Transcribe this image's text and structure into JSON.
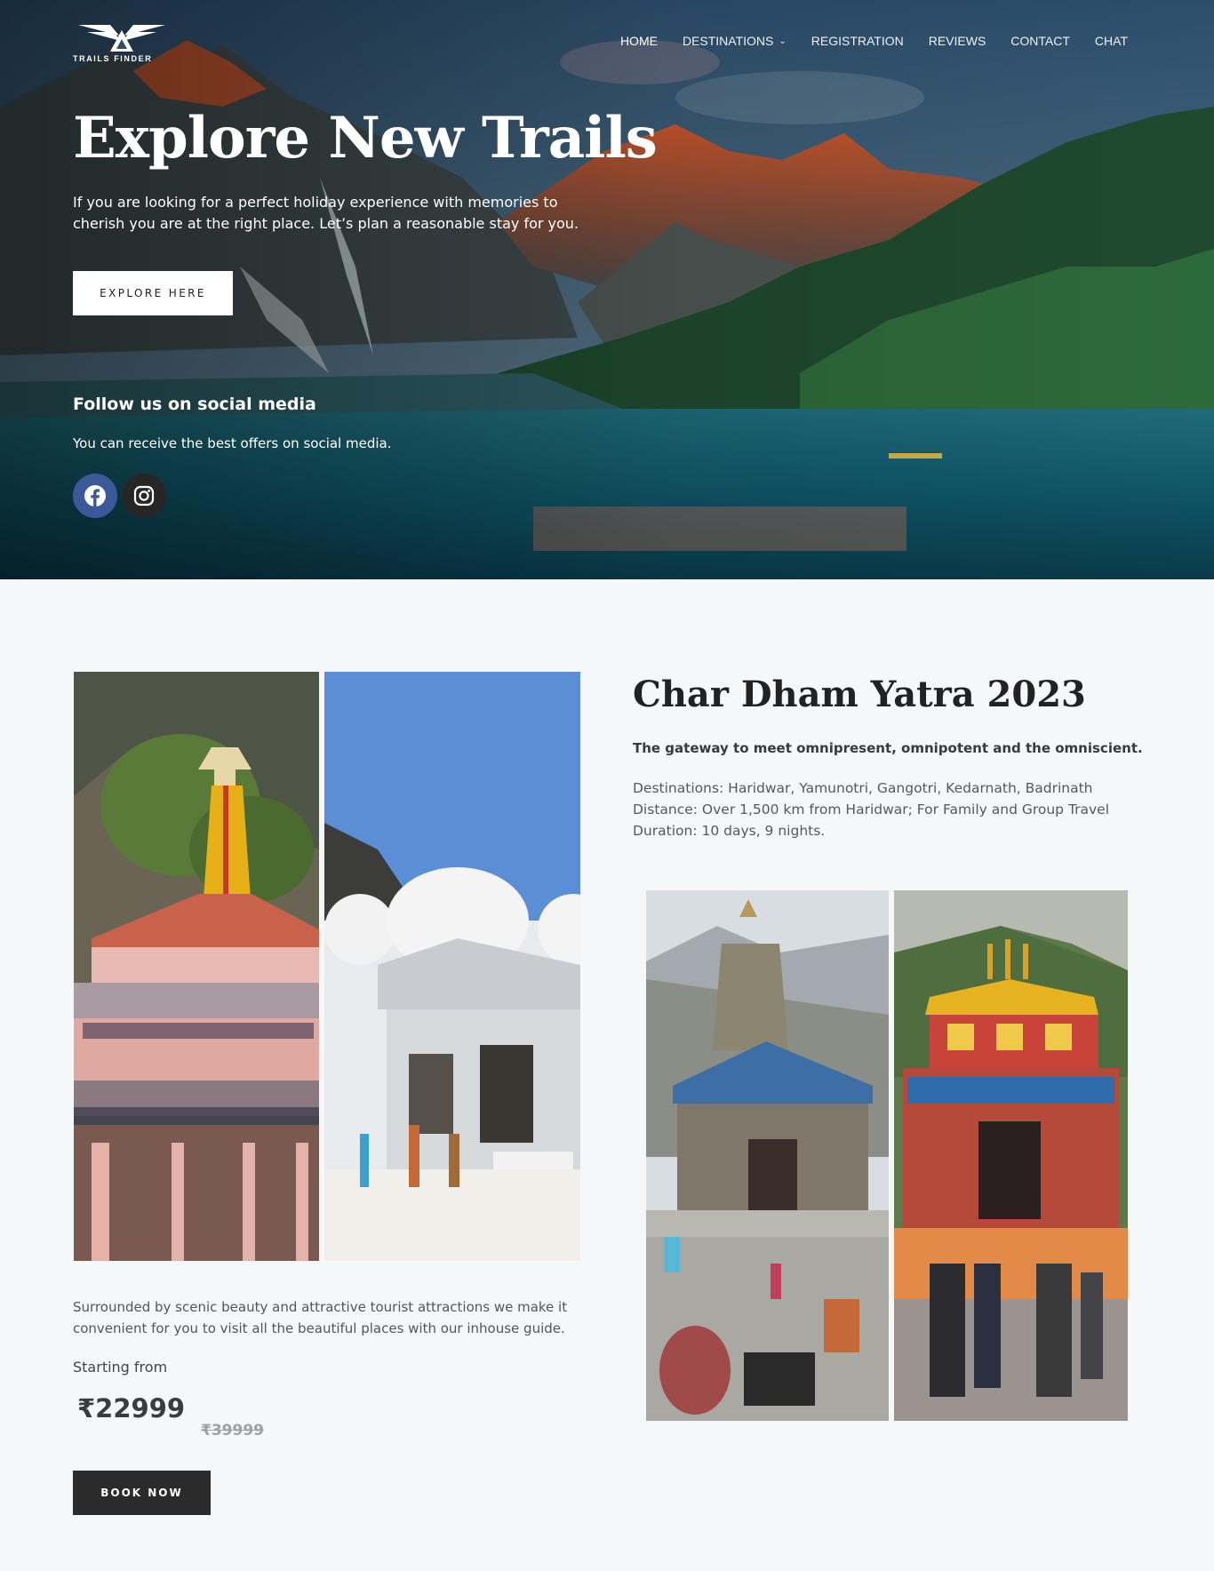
{
  "brand": {
    "logo_text": "TRAILS FINDER"
  },
  "nav": {
    "items": [
      {
        "label": "HOME"
      },
      {
        "label": "DESTINATIONS"
      },
      {
        "label": "REGISTRATION"
      },
      {
        "label": "REVIEWS"
      },
      {
        "label": "CONTACT"
      },
      {
        "label": "CHAT"
      }
    ]
  },
  "hero": {
    "title": "Explore New Trails",
    "subtitle": "If you are looking for a perfect holiday experience with memories to cherish you are at the right place. Let’s plan a reasonable stay for you.",
    "cta": "EXPLORE HERE",
    "follow_title": "Follow us on social media",
    "follow_sub": "You can receive the best offers on social media.",
    "social": [
      "facebook-icon",
      "instagram-icon"
    ]
  },
  "tour": {
    "title": "Char Dham Yatra 2023",
    "tagline": "The gateway to meet omnipresent, omnipotent and the omniscient.",
    "destinations": "Destinations: Haridwar, Yamunotri, Gangotri, Kedarnath, Badrinath",
    "distance": "Distance: Over 1,500 km from Haridwar; For Family and Group Travel",
    "duration": "Duration: 10 days, 9 nights.",
    "description": "Surrounded by scenic beauty and attractive tourist attractions we make it convenient for you to visit all the beautiful places with our inhouse guide.",
    "starting_label": "Starting from",
    "price": "₹22999",
    "old_price": "₹39999",
    "book_cta": "BOOK NOW"
  }
}
